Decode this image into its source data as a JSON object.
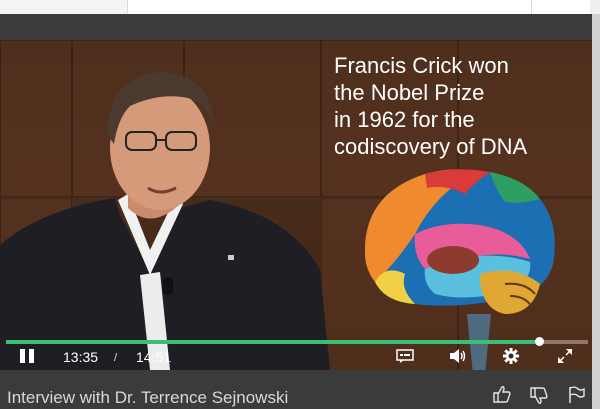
{
  "video": {
    "caption_lines": [
      "Francis Crick won",
      "the Nobel Prize",
      "in 1962 for the",
      "codiscovery of DNA"
    ],
    "current_time": "13:35",
    "separator": "/",
    "duration": "14:51",
    "progress_fraction": 0.915
  },
  "page": {
    "title": "Interview with Dr. Terrence Sejnowski"
  },
  "icons": [
    "pause-icon",
    "captions-icon",
    "volume-icon",
    "settings-icon",
    "fullscreen-icon",
    "thumbs-up-icon",
    "thumbs-down-icon",
    "flag-icon"
  ],
  "colors": {
    "progress": "#3bbf77",
    "background": "#3b3b3b"
  }
}
